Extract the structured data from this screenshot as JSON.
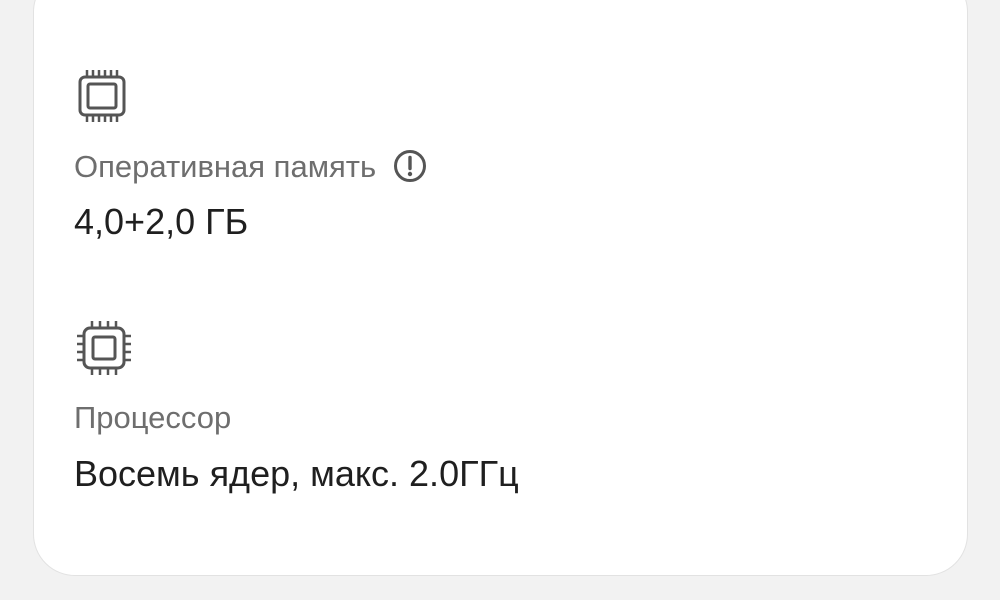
{
  "ram": {
    "icon": "memory-chip-icon",
    "label": "Оперативная память",
    "info_icon": "info-exclamation-icon",
    "value": "4,0+2,0 ГБ"
  },
  "cpu": {
    "icon": "processor-chip-icon",
    "label": "Процессор",
    "value": "Восемь ядер, макс. 2.0ГГц"
  },
  "colors": {
    "icon": "#555555",
    "label": "#6e6e6e",
    "value": "#1f1f1f",
    "card_background": "#ffffff",
    "page_background": "#f2f2f2"
  }
}
